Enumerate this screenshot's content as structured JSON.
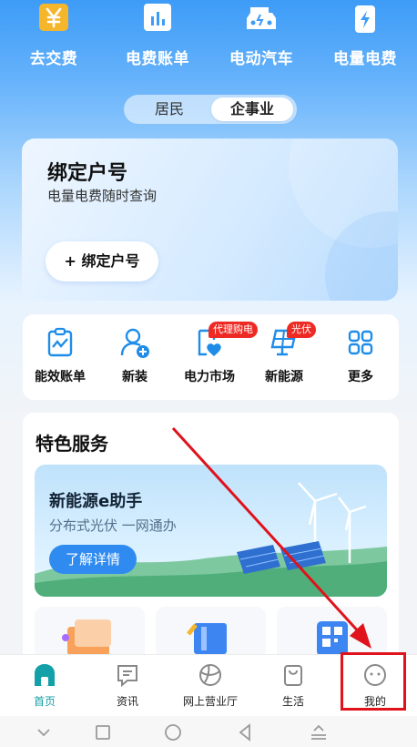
{
  "top_shortcuts": [
    {
      "label": "去交费",
      "icon": "yen-icon"
    },
    {
      "label": "电费账单",
      "icon": "bill-chart-icon"
    },
    {
      "label": "电动汽车",
      "icon": "ev-car-icon"
    },
    {
      "label": "电量电费",
      "icon": "battery-bolt-icon"
    }
  ],
  "segment": {
    "options": [
      "居民",
      "企事业"
    ],
    "selected": "企事业"
  },
  "bind_card": {
    "title": "绑定户号",
    "subtitle": "电量电费随时查询",
    "button": "+ 绑定户号"
  },
  "services": [
    {
      "label": "能效账单",
      "icon": "efficiency-bill-icon",
      "badge": ""
    },
    {
      "label": "新装",
      "icon": "add-user-icon",
      "badge": ""
    },
    {
      "label": "电力市场",
      "icon": "power-market-icon",
      "badge": "代理购电"
    },
    {
      "label": "新能源",
      "icon": "solar-panel-icon",
      "badge": "光伏"
    },
    {
      "label": "更多",
      "icon": "grid-more-icon",
      "badge": ""
    }
  ],
  "featured": {
    "title": "特色服务",
    "banner": {
      "title": "新能源e助手",
      "subtitle": "分布式光伏 一网通办",
      "button": "了解详情"
    }
  },
  "tabbar": [
    {
      "label": "首页",
      "icon": "home-icon",
      "active": true
    },
    {
      "label": "资讯",
      "icon": "news-icon",
      "active": false
    },
    {
      "label": "网上营业厅",
      "icon": "globe-icon",
      "active": false
    },
    {
      "label": "生活",
      "icon": "shopping-bag-icon",
      "active": false
    },
    {
      "label": "我的",
      "icon": "profile-face-icon",
      "active": false
    }
  ],
  "system_nav": [
    "chevron-down-icon",
    "square-icon",
    "circle-icon",
    "back-triangle-icon",
    "menu-up-icon"
  ],
  "colors": {
    "accent": "#2f8bf0",
    "tab_active": "#14a0a8",
    "badge": "#ee2a24",
    "annotation": "#e0121b"
  }
}
